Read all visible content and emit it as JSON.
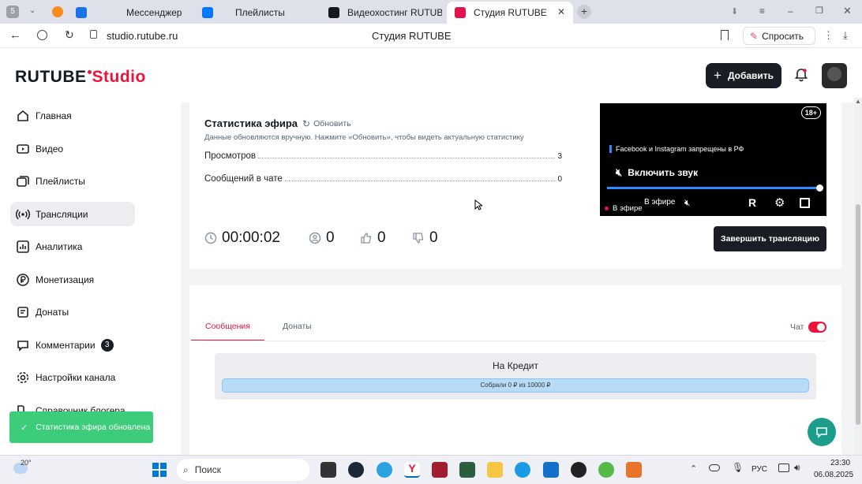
{
  "browser": {
    "profile_badge": "5",
    "tabs": [
      {
        "label": "Мессенджер",
        "color": "#1a73e8"
      },
      {
        "label": "Плейлисты",
        "color": "#0077ff"
      },
      {
        "label": "Видеохостинг RUTUBE. С",
        "color": "#14191f"
      },
      {
        "label": "Студия RUTUBE",
        "color": "#e0164c"
      }
    ],
    "url": "studio.rutube.ru",
    "page_title": "Студия RUTUBE",
    "ask_label": "Спросить"
  },
  "header": {
    "logo_main": "RUTUBE",
    "logo_sub": "Studio",
    "add_label": "Добавить"
  },
  "sidebar": {
    "items": [
      {
        "label": "Главная",
        "icon": "home-icon"
      },
      {
        "label": "Видео",
        "icon": "video-icon"
      },
      {
        "label": "Плейлисты",
        "icon": "playlist-icon"
      },
      {
        "label": "Трансляции",
        "icon": "broadcast-icon",
        "active": true
      },
      {
        "label": "Аналитика",
        "icon": "analytics-icon"
      },
      {
        "label": "Монетизация",
        "icon": "monetization-icon"
      },
      {
        "label": "Донаты",
        "icon": "donations-icon"
      },
      {
        "label": "Комментарии",
        "icon": "comments-icon",
        "badge": "3"
      },
      {
        "label": "Настройки канала",
        "icon": "settings-icon"
      },
      {
        "label": "Справочник блогера",
        "icon": "guide-icon"
      }
    ]
  },
  "stats": {
    "title": "Статистика эфира",
    "refresh_label": "Обновить",
    "note": "Данные обновляются вручную. Нажмите «Обновить», чтобы видеть актуальную статистику",
    "rows": [
      {
        "label": "Просмотров",
        "value": "3"
      },
      {
        "label": "Сообщений в чате",
        "value": "0"
      }
    ],
    "timer": "00:00:02",
    "viewers": "0",
    "likes": "0",
    "dislikes": "0"
  },
  "player": {
    "age_badge": "18+",
    "notice": "Facebook и Instagram запрещены в РФ",
    "sound_label": "Включить звук",
    "live_label": "В эфире",
    "progress": 1.0
  },
  "end_button": "Завершить трансляцию",
  "chat_panel": {
    "tabs": [
      "Сообщения",
      "Донаты"
    ],
    "toggle_label": "Чат",
    "goal_title": "На Кредит",
    "goal_text": "Собрали 0 ₽ из 10000 ₽"
  },
  "toast": "Статистика эфира обновлена",
  "taskbar": {
    "weather": "20°",
    "search": "Поиск",
    "lang": "РУС",
    "time": "23:30",
    "date": "06.08.2025"
  },
  "colors": {
    "brand_red": "#ed143b",
    "toast_green": "#3dcc7a",
    "primary_dark": "#1a1d23"
  }
}
